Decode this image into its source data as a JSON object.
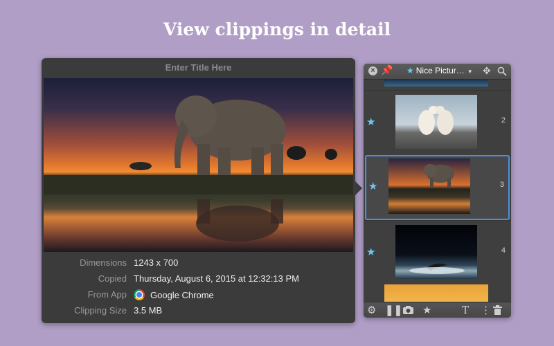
{
  "headline": "View clippings in detail",
  "detail": {
    "title_placeholder": "Enter Title Here",
    "meta": [
      {
        "label": "Dimensions",
        "value": "1243 x 700"
      },
      {
        "label": "Copied",
        "value": "Thursday, August 6, 2015 at 12:32:13 PM"
      },
      {
        "label": "From App",
        "value": "Google Chrome",
        "icon": "chrome-icon"
      },
      {
        "label": "Clipping Size",
        "value": "3.5 MB"
      }
    ]
  },
  "list": {
    "folder_name": "Nice Pictur…",
    "items": [
      {
        "index": "2",
        "starred": true,
        "thumb": "polar-bears"
      },
      {
        "index": "3",
        "starred": true,
        "thumb": "elephant-sunset",
        "selected": true
      },
      {
        "index": "4",
        "starred": true,
        "thumb": "whale-breach"
      }
    ],
    "header_icons": [
      "close-icon",
      "pin-icon",
      "star-icon",
      "move-icon",
      "search-icon"
    ],
    "footer_icons": [
      "gear-icon",
      "pause-icon",
      "camera-icon",
      "star-settings-icon",
      "text-icon",
      "more-icon",
      "trash-icon"
    ]
  },
  "colors": {
    "background": "#b09ec6",
    "panel": "#3b3b3b",
    "selection": "#4a90e2",
    "star": "#6ec6f5"
  }
}
